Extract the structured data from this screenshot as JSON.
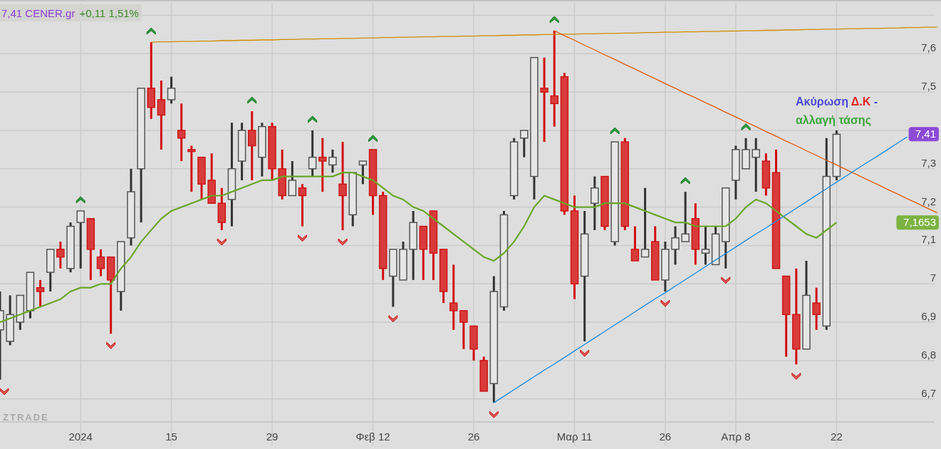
{
  "ticker": {
    "price_symbol": "7,41 CENER.gr",
    "change": "+0,11 1,51%"
  },
  "watermark": "ZTRADE",
  "note": {
    "lines": [
      [
        {
          "text": "Ακύρωση",
          "color": "#4a48d8"
        },
        {
          "text": "Δ.Κ",
          "color": "#e42424"
        },
        {
          "text": "-",
          "color": "#4a48d8"
        }
      ],
      [
        {
          "text": "αλλαγή τάσης",
          "color": "#3aa83a"
        }
      ]
    ]
  },
  "price_tags": [
    {
      "label": "7,41",
      "color": "#8c4ad6"
    },
    {
      "label": "7,1653",
      "color": "#7cb342"
    }
  ],
  "chart_data": {
    "type": "candlestick",
    "grid": true,
    "ylim": [
      6.64,
      7.74
    ],
    "categories": [
      null,
      null,
      null,
      null,
      null,
      null,
      null,
      null,
      "2024",
      null,
      null,
      null,
      null,
      null,
      null,
      null,
      null,
      "15",
      null,
      null,
      null,
      null,
      null,
      null,
      null,
      null,
      null,
      "29",
      null,
      null,
      null,
      null,
      null,
      null,
      null,
      null,
      null,
      "Φεβ 12",
      null,
      null,
      null,
      null,
      null,
      null,
      null,
      null,
      null,
      "26",
      null,
      null,
      null,
      null,
      null,
      null,
      null,
      null,
      null,
      "Μαρ 11",
      null,
      null,
      null,
      null,
      null,
      null,
      null,
      null,
      "26",
      null,
      null,
      null,
      null,
      null,
      null,
      "Απρ 8",
      null,
      null,
      null,
      null,
      null,
      null,
      null,
      null,
      null,
      "22",
      null,
      null,
      null,
      null,
      null,
      null,
      null,
      null,
      null,
      null
    ],
    "yticks": [
      {
        "value": 6.7,
        "label": "6,7"
      },
      {
        "value": 6.8,
        "label": "6,8"
      },
      {
        "value": 6.9,
        "label": "6,9"
      },
      {
        "value": 7.0,
        "label": "7"
      },
      {
        "value": 7.1,
        "label": "7,1"
      },
      {
        "value": 7.2,
        "label": "7,2"
      },
      {
        "value": 7.3,
        "label": "7,3"
      },
      {
        "value": 7.5,
        "label": "7,5"
      },
      {
        "value": 7.6,
        "label": "7,6"
      }
    ],
    "ohlc": [
      [
        6.88,
        6.98,
        6.75,
        6.93
      ],
      [
        6.85,
        6.97,
        6.84,
        6.92
      ],
      [
        6.9,
        6.97,
        6.88,
        6.97
      ],
      [
        6.93,
        7.03,
        6.91,
        7.03
      ],
      [
        6.99,
        7.01,
        6.94,
        6.98
      ],
      [
        7.03,
        7.09,
        6.98,
        7.09
      ],
      [
        7.09,
        7.11,
        7.04,
        7.07
      ],
      [
        7.04,
        7.16,
        7.03,
        7.15
      ],
      [
        7.16,
        7.19,
        7.04,
        7.19
      ],
      [
        7.17,
        7.17,
        7.01,
        7.09
      ],
      [
        7.07,
        7.09,
        7.02,
        7.04
      ],
      [
        7.07,
        7.07,
        6.87,
        7.01
      ],
      [
        6.98,
        7.11,
        6.93,
        7.11
      ],
      [
        7.12,
        7.3,
        7.1,
        7.24
      ],
      [
        7.3,
        7.51,
        7.16,
        7.51
      ],
      [
        7.51,
        7.63,
        7.43,
        7.46
      ],
      [
        7.48,
        7.53,
        7.35,
        7.44
      ],
      [
        7.48,
        7.54,
        7.47,
        7.51
      ],
      [
        7.4,
        7.47,
        7.32,
        7.38
      ],
      [
        7.35,
        7.36,
        7.24,
        7.345
      ],
      [
        7.33,
        7.33,
        7.22,
        7.26
      ],
      [
        7.27,
        7.34,
        7.21,
        7.21
      ],
      [
        7.21,
        7.25,
        7.14,
        7.16
      ],
      [
        7.22,
        7.42,
        7.15,
        7.3
      ],
      [
        7.32,
        7.42,
        7.27,
        7.4
      ],
      [
        7.4,
        7.45,
        7.27,
        7.36
      ],
      [
        7.33,
        7.42,
        7.28,
        7.41
      ],
      [
        7.41,
        7.42,
        7.27,
        7.3
      ],
      [
        7.3,
        7.35,
        7.22,
        7.23
      ],
      [
        7.23,
        7.32,
        7.23,
        7.27
      ],
      [
        7.25,
        7.26,
        7.15,
        7.23
      ],
      [
        7.3,
        7.4,
        7.28,
        7.33
      ],
      [
        7.33,
        7.38,
        7.24,
        7.32
      ],
      [
        7.31,
        7.35,
        7.29,
        7.33
      ],
      [
        7.26,
        7.37,
        7.14,
        7.23
      ],
      [
        7.18,
        7.29,
        7.15,
        7.29
      ],
      [
        7.31,
        7.32,
        7.26,
        7.32
      ],
      [
        7.35,
        7.35,
        7.18,
        7.23
      ],
      [
        7.23,
        7.24,
        7.01,
        7.04
      ],
      [
        7.02,
        7.09,
        6.94,
        7.09
      ],
      [
        7.01,
        7.11,
        7.01,
        7.09
      ],
      [
        7.09,
        7.19,
        7.01,
        7.16
      ],
      [
        7.15,
        7.15,
        7.01,
        7.09
      ],
      [
        7.19,
        7.19,
        7.01,
        7.08
      ],
      [
        7.09,
        7.09,
        6.95,
        6.98
      ],
      [
        6.95,
        7.05,
        6.88,
        6.93
      ],
      [
        6.93,
        6.93,
        6.83,
        6.9
      ],
      [
        6.89,
        6.89,
        6.8,
        6.83
      ],
      [
        6.8,
        6.81,
        6.72,
        6.72
      ],
      [
        6.74,
        7.02,
        6.69,
        6.98
      ],
      [
        6.94,
        7.19,
        6.93,
        7.18
      ],
      [
        7.23,
        7.38,
        7.22,
        7.37
      ],
      [
        7.38,
        7.4,
        7.33,
        7.4
      ],
      [
        7.28,
        7.59,
        7.22,
        7.59
      ],
      [
        7.51,
        7.59,
        7.37,
        7.5
      ],
      [
        7.49,
        7.66,
        7.41,
        7.47
      ],
      [
        7.54,
        7.55,
        7.18,
        7.19
      ],
      [
        7.19,
        7.23,
        6.96,
        7.0
      ],
      [
        7.02,
        7.19,
        6.85,
        7.13
      ],
      [
        7.21,
        7.28,
        7.14,
        7.25
      ],
      [
        7.28,
        7.28,
        7.14,
        7.15
      ],
      [
        7.11,
        7.37,
        7.1,
        7.37
      ],
      [
        7.37,
        7.38,
        7.14,
        7.15
      ],
      [
        7.09,
        7.15,
        7.06,
        7.06
      ],
      [
        7.07,
        7.25,
        7.07,
        7.09
      ],
      [
        7.11,
        7.15,
        7.01,
        7.01
      ],
      [
        7.01,
        7.11,
        6.98,
        7.09
      ],
      [
        7.09,
        7.15,
        7.05,
        7.12
      ],
      [
        7.11,
        7.24,
        7.11,
        7.13
      ],
      [
        7.17,
        7.21,
        7.05,
        7.09
      ],
      [
        7.08,
        7.15,
        7.05,
        7.09
      ],
      [
        7.05,
        7.15,
        7.05,
        7.13
      ],
      [
        7.11,
        7.25,
        7.04,
        7.25
      ],
      [
        7.27,
        7.36,
        7.22,
        7.35
      ],
      [
        7.3,
        7.38,
        7.3,
        7.35
      ],
      [
        7.33,
        7.38,
        7.24,
        7.35
      ],
      [
        7.32,
        7.34,
        7.23,
        7.25
      ],
      [
        7.29,
        7.35,
        7.04,
        7.04
      ],
      [
        7.02,
        7.02,
        6.81,
        6.92
      ],
      [
        6.92,
        7.04,
        6.79,
        6.83
      ],
      [
        6.83,
        7.06,
        6.83,
        6.97
      ],
      [
        6.95,
        6.99,
        6.88,
        6.92
      ],
      [
        6.89,
        7.38,
        6.88,
        7.28
      ],
      [
        7.28,
        7.4,
        7.27,
        7.39
      ],
      null,
      null,
      null,
      null,
      null,
      null,
      null,
      null,
      null,
      null
    ],
    "series": [
      {
        "type": "line",
        "color": "#6aa629",
        "values": [
          6.9,
          6.91,
          6.92,
          6.93,
          6.94,
          6.95,
          6.96,
          6.98,
          6.99,
          6.99,
          7.0,
          7.0,
          7.04,
          7.07,
          7.11,
          7.14,
          7.17,
          7.19,
          7.2,
          7.21,
          7.22,
          7.23,
          7.23,
          7.24,
          7.25,
          7.26,
          7.27,
          7.27,
          7.28,
          7.28,
          7.28,
          7.28,
          7.28,
          7.28,
          7.29,
          7.29,
          7.28,
          7.27,
          7.25,
          7.23,
          7.22,
          7.2,
          7.19,
          7.17,
          7.15,
          7.13,
          7.11,
          7.09,
          7.07,
          7.06,
          7.08,
          7.11,
          7.15,
          7.2,
          7.23,
          7.22,
          7.21,
          7.2,
          7.2,
          7.2,
          7.21,
          7.21,
          7.21,
          7.2,
          7.19,
          7.18,
          7.17,
          7.16,
          7.16,
          7.15,
          7.15,
          7.15,
          7.15,
          7.17,
          7.2,
          7.22,
          7.21,
          7.19,
          7.17,
          7.15,
          7.13,
          7.12,
          7.14,
          7.16,
          null,
          null,
          null,
          null,
          null,
          null,
          null,
          null,
          null,
          null
        ]
      },
      {
        "type": "line",
        "color": "#d08c00",
        "values": [
          null,
          null,
          null,
          null,
          null,
          null,
          null,
          null,
          null,
          null,
          null,
          null,
          null,
          null,
          null,
          7.63,
          7.631,
          7.631,
          7.632,
          7.632,
          7.633,
          7.633,
          7.634,
          7.634,
          7.635,
          7.635,
          7.636,
          7.636,
          7.637,
          7.637,
          7.638,
          7.638,
          7.639,
          7.639,
          7.64,
          7.64,
          7.641,
          7.641,
          7.642,
          7.642,
          7.643,
          7.643,
          7.644,
          7.644,
          7.645,
          7.645,
          7.646,
          7.646,
          7.647,
          7.647,
          7.648,
          7.648,
          7.649,
          7.649,
          7.65,
          7.65,
          7.651,
          7.651,
          7.652,
          7.652,
          7.653,
          7.653,
          7.654,
          7.654,
          7.655,
          7.655,
          7.656,
          7.656,
          7.657,
          7.657,
          7.658,
          7.658,
          7.659,
          7.659,
          7.66,
          7.66,
          7.661,
          7.661,
          7.662,
          7.662,
          7.663,
          7.663,
          7.664,
          7.664,
          7.665,
          7.665,
          7.666,
          7.666,
          7.667,
          7.667,
          7.668,
          7.668,
          7.669,
          7.669
        ]
      },
      {
        "type": "line",
        "color": "#e05a10",
        "values": [
          null,
          null,
          null,
          null,
          null,
          null,
          null,
          null,
          null,
          null,
          null,
          null,
          null,
          null,
          null,
          null,
          null,
          null,
          null,
          null,
          null,
          null,
          null,
          null,
          null,
          null,
          null,
          null,
          null,
          null,
          null,
          null,
          null,
          null,
          null,
          null,
          null,
          null,
          null,
          null,
          null,
          null,
          null,
          null,
          null,
          null,
          null,
          null,
          null,
          null,
          null,
          null,
          null,
          null,
          null,
          7.66,
          7.647,
          7.635,
          7.622,
          7.61,
          7.597,
          7.585,
          7.572,
          7.56,
          7.547,
          7.535,
          7.522,
          7.51,
          7.497,
          7.485,
          7.472,
          7.46,
          7.447,
          7.435,
          7.422,
          7.41,
          7.397,
          7.385,
          7.372,
          7.36,
          7.347,
          7.335,
          7.322,
          7.31,
          7.297,
          7.285,
          7.272,
          7.26,
          7.247,
          7.235,
          7.222,
          7.21,
          7.197,
          7.185
        ]
      },
      {
        "type": "line",
        "color": "#1a8ae0",
        "values": [
          null,
          null,
          null,
          null,
          null,
          null,
          null,
          null,
          null,
          null,
          null,
          null,
          null,
          null,
          null,
          null,
          null,
          null,
          null,
          null,
          null,
          null,
          null,
          null,
          null,
          null,
          null,
          null,
          null,
          null,
          null,
          null,
          null,
          null,
          null,
          null,
          null,
          null,
          null,
          null,
          null,
          null,
          null,
          null,
          null,
          null,
          null,
          null,
          null,
          6.69,
          6.707,
          6.724,
          6.741,
          6.758,
          6.775,
          6.791,
          6.808,
          6.825,
          6.842,
          6.859,
          6.876,
          6.893,
          6.91,
          6.927,
          6.944,
          6.961,
          6.977,
          6.994,
          7.011,
          7.028,
          7.045,
          7.062,
          7.079,
          7.096,
          7.113,
          7.13,
          7.146,
          7.163,
          7.18,
          7.197,
          7.214,
          7.231,
          7.248,
          7.265,
          7.282,
          7.299,
          7.316,
          7.332,
          7.349,
          7.366,
          7.383,
          null,
          null,
          null
        ]
      },
      {
        "type": "scatter",
        "color": "#2e9a3e",
        "values": [
          null,
          null,
          null,
          null,
          null,
          null,
          null,
          null,
          7.22,
          null,
          null,
          null,
          null,
          null,
          null,
          7.66,
          null,
          null,
          null,
          null,
          null,
          null,
          null,
          null,
          null,
          7.48,
          null,
          null,
          null,
          null,
          null,
          7.43,
          null,
          null,
          null,
          null,
          null,
          7.38,
          null,
          null,
          null,
          null,
          null,
          null,
          null,
          null,
          null,
          null,
          null,
          null,
          null,
          null,
          null,
          null,
          null,
          7.69,
          null,
          null,
          null,
          null,
          null,
          7.4,
          null,
          null,
          null,
          null,
          null,
          null,
          7.27,
          null,
          null,
          null,
          null,
          null,
          7.41,
          null,
          null,
          null,
          null,
          null,
          null,
          null,
          null,
          null,
          null,
          null,
          null,
          null,
          null,
          null,
          null,
          null,
          null,
          null
        ]
      },
      {
        "type": "scatter",
        "color": "#e05555",
        "values": [
          6.72,
          null,
          null,
          null,
          null,
          null,
          null,
          null,
          null,
          null,
          null,
          6.84,
          null,
          null,
          null,
          null,
          null,
          null,
          null,
          null,
          null,
          null,
          7.11,
          null,
          null,
          null,
          null,
          null,
          null,
          null,
          7.12,
          null,
          null,
          null,
          7.11,
          null,
          null,
          null,
          null,
          6.91,
          null,
          null,
          null,
          null,
          null,
          null,
          null,
          null,
          null,
          6.66,
          null,
          null,
          null,
          null,
          null,
          null,
          null,
          null,
          6.82,
          null,
          null,
          null,
          null,
          null,
          null,
          null,
          6.95,
          null,
          null,
          null,
          null,
          null,
          7.01,
          null,
          null,
          null,
          null,
          null,
          null,
          6.76,
          null,
          null,
          null,
          null,
          null,
          null,
          null,
          null,
          null,
          null,
          null,
          null,
          null,
          null
        ]
      }
    ]
  }
}
